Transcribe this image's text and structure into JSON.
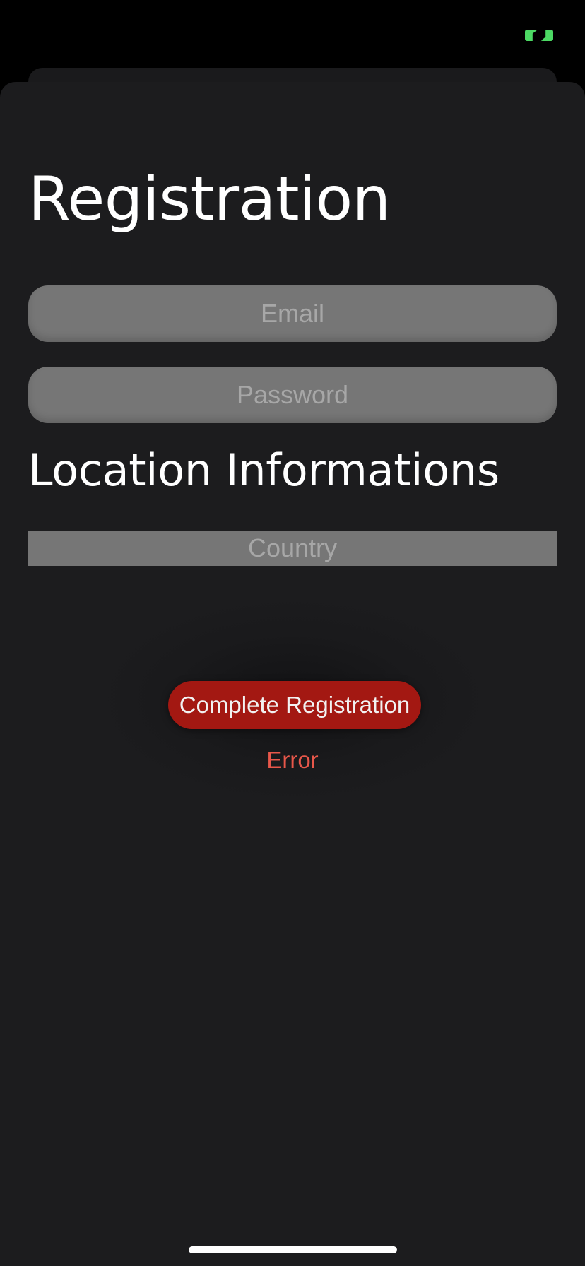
{
  "status_bar": {
    "indicator_color": "#4cd964"
  },
  "registration": {
    "title": "Registration",
    "email_placeholder": "Email",
    "password_placeholder": "Password",
    "location_section_title": "Location Informations",
    "country_placeholder": "Country",
    "complete_button_label": "Complete Registration",
    "error_message": "Error"
  },
  "colors": {
    "background": "#1c1c1e",
    "field_background": "#767676",
    "button_background": "#a31812",
    "error_text": "#e8574a"
  }
}
